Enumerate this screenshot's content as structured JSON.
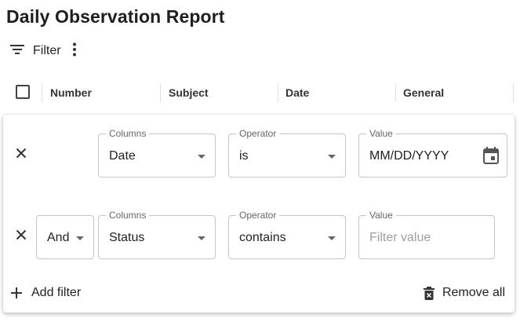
{
  "page": {
    "title": "Daily Observation Report"
  },
  "toolbar": {
    "filter_label": "Filter"
  },
  "table": {
    "columns": [
      "Number",
      "Subject",
      "Date",
      "General"
    ]
  },
  "filter_panel": {
    "rows": [
      {
        "logic_operator": "",
        "column_label": "Columns",
        "column_value": "Date",
        "operator_label": "Operator",
        "operator_value": "is",
        "value_label": "Value",
        "value_placeholder": "MM/DD/YYYY"
      },
      {
        "logic_operator": "And",
        "column_label": "Columns",
        "column_value": "Status",
        "operator_label": "Operator",
        "operator_value": "contains",
        "value_label": "Value",
        "value_placeholder": "Filter value"
      }
    ],
    "add_filter_label": "Add filter",
    "remove_all_label": "Remove all"
  }
}
